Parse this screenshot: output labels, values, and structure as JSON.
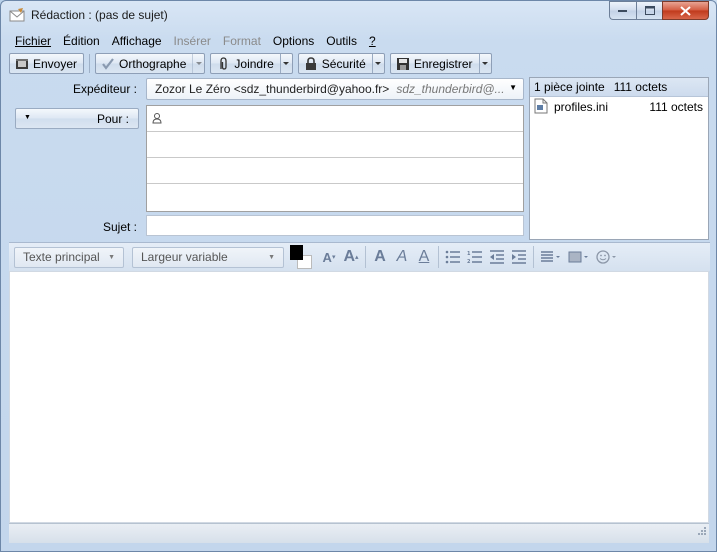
{
  "window": {
    "title": "Rédaction : (pas de sujet)"
  },
  "menu": [
    {
      "label": "Fichier",
      "ul": "F",
      "rest": "ichier",
      "disabled": false
    },
    {
      "label": "Édition",
      "ul": "É",
      "rest": "dition",
      "disabled": false
    },
    {
      "label": "Affichage",
      "ul": "A",
      "rest": "ffichage",
      "disabled": false
    },
    {
      "label": "Insérer",
      "disabled": true
    },
    {
      "label": "Format",
      "disabled": true
    },
    {
      "label": "Options",
      "disabled": false
    },
    {
      "label": "Outils",
      "disabled": false
    },
    {
      "label": "?",
      "disabled": false
    }
  ],
  "menu_labels": {
    "fichier": "Fichier",
    "edition": "Édition",
    "affichage": "Affichage",
    "inserer": "Insérer",
    "format": "Format",
    "options": "Options",
    "outils": "Outils",
    "help": "?"
  },
  "toolbar": {
    "send": "Envoyer",
    "spell": "Orthographe",
    "attach": "Joindre",
    "security": "Sécurité",
    "save": "Enregistrer"
  },
  "header": {
    "from_label": "Expéditeur :",
    "from_value": "Zozor Le Zéro <sdz_thunderbird@yahoo.fr>",
    "from_identity": "sdz_thunderbird@...",
    "to_label": "Pour :",
    "subject_label": "Sujet :",
    "subject_value": ""
  },
  "attachments": {
    "summary_count": "1 pièce jointe",
    "summary_size": "111 octets",
    "items": [
      {
        "name": "profiles.ini",
        "size": "111 octets"
      }
    ]
  },
  "format": {
    "paragraph_style": "Texte principal",
    "font": "Largeur variable"
  },
  "colors": {
    "text_color": "#000000",
    "background_color": "#ffffff",
    "accent": "#c9dbef"
  }
}
